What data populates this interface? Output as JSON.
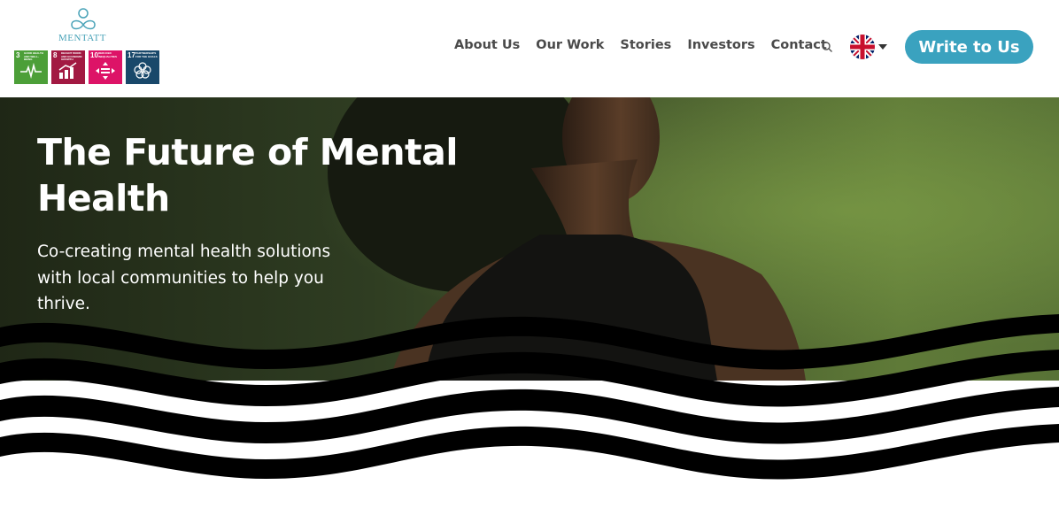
{
  "brand": {
    "name": "MENTATT",
    "accent": "#3aa2bf"
  },
  "sdg_badges": [
    {
      "number": "3",
      "title": "Good health and well-being",
      "color": "#4c9f38",
      "icon": "heartbeat-icon"
    },
    {
      "number": "8",
      "title": "Decent work and economic growth",
      "color": "#a21942",
      "icon": "growth-chart-icon"
    },
    {
      "number": "10",
      "title": "Reduced inequalities",
      "color": "#dd1367",
      "icon": "equality-icon"
    },
    {
      "number": "17",
      "title": "Partnerships for the goals",
      "color": "#19486a",
      "icon": "flower-icon"
    }
  ],
  "nav": {
    "items": [
      "About Us",
      "Our Work",
      "Stories",
      "Investors",
      "Contact"
    ],
    "search_icon": "search-icon",
    "language_icon": "uk-flag-icon",
    "cta_label": "Write to Us"
  },
  "hero": {
    "title": "The Future of Mental Health",
    "subtitle": "Co-creating mental health solutions with local communities to help you thrive."
  }
}
